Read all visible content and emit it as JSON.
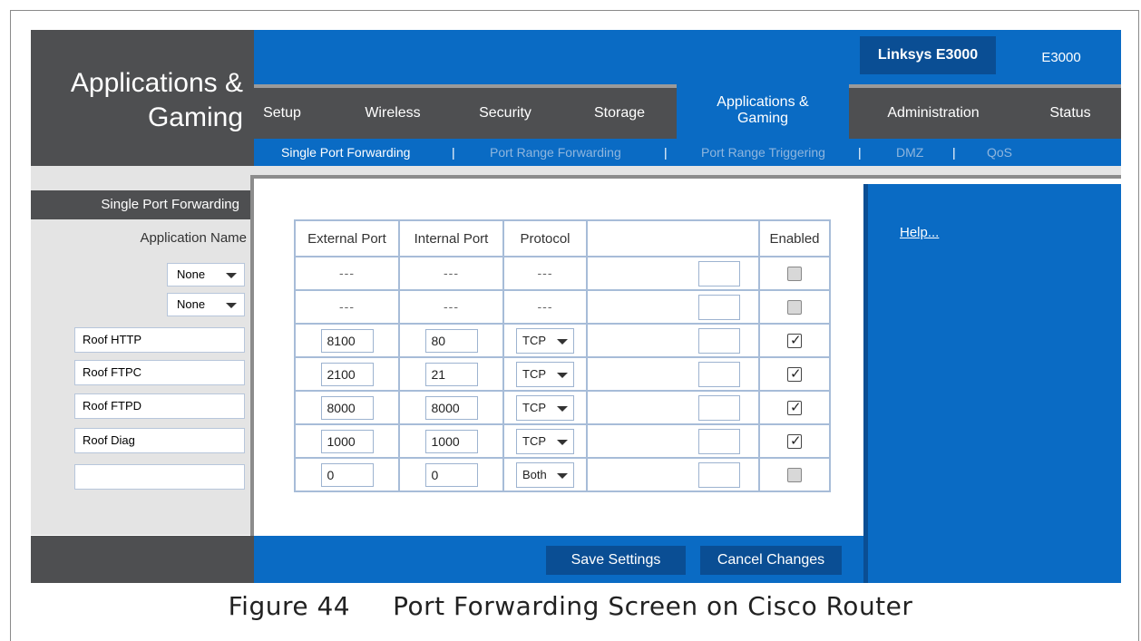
{
  "header": {
    "page_title_line1": "Applications &",
    "page_title_line2": "Gaming",
    "model_name": "Linksys E3000",
    "model_short": "E3000"
  },
  "nav": {
    "items": [
      {
        "label": "Setup"
      },
      {
        "label": "Wireless"
      },
      {
        "label": "Security"
      },
      {
        "label": "Storage"
      },
      {
        "label": "Applications & Gaming",
        "active": true
      },
      {
        "label": "Administration"
      },
      {
        "label": "Status"
      }
    ]
  },
  "subnav": {
    "items": [
      {
        "label": "Single Port Forwarding",
        "active": true
      },
      {
        "label": "Port Range Forwarding"
      },
      {
        "label": "Port Range Triggering"
      },
      {
        "label": "DMZ"
      },
      {
        "label": "QoS"
      }
    ],
    "separator": "|"
  },
  "sidebar": {
    "section_label": "Single Port Forwarding",
    "app_name_label": "Application Name"
  },
  "table": {
    "headers": [
      "External Port",
      "Internal Port",
      "Protocol",
      "",
      "Enabled"
    ],
    "rows": [
      {
        "app": "None",
        "app_type": "select",
        "external": "---",
        "internal": "---",
        "protocol": "---",
        "editable": false,
        "enabled": false
      },
      {
        "app": "None",
        "app_type": "select",
        "external": "---",
        "internal": "---",
        "protocol": "---",
        "editable": false,
        "enabled": false
      },
      {
        "app": "Roof HTTP",
        "app_type": "input",
        "external": "8100",
        "internal": "80",
        "protocol": "TCP",
        "editable": true,
        "enabled": true
      },
      {
        "app": "Roof FTPC",
        "app_type": "input",
        "external": "2100",
        "internal": "21",
        "protocol": "TCP",
        "editable": true,
        "enabled": true
      },
      {
        "app": "Roof FTPD",
        "app_type": "input",
        "external": "8000",
        "internal": "8000",
        "protocol": "TCP",
        "editable": true,
        "enabled": true
      },
      {
        "app": "Roof Diag",
        "app_type": "input",
        "external": "1000",
        "internal": "1000",
        "protocol": "TCP",
        "editable": true,
        "enabled": true
      },
      {
        "app": "",
        "app_type": "input",
        "external": "0",
        "internal": "0",
        "protocol": "Both",
        "editable": true,
        "enabled": false
      }
    ]
  },
  "help": {
    "link_label": "Help..."
  },
  "footer": {
    "save_label": "Save Settings",
    "cancel_label": "Cancel Changes"
  },
  "caption": "Figure 44     Port Forwarding Screen on Cisco Router",
  "colors": {
    "brand_blue": "#0a6bc4",
    "dark_blue": "#0a4e94",
    "dark_gray": "#4e4f51",
    "light_gray": "#e4e4e4"
  }
}
